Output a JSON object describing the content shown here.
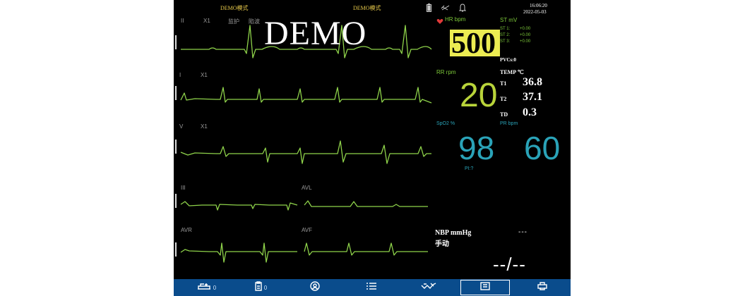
{
  "top_bar": {
    "mode_left": "DEMO模式",
    "mode_center": "DEMO模式",
    "time": "16:06:20",
    "date": "2022-05-03"
  },
  "watermark": "DEMO",
  "waves": [
    {
      "lead": "II",
      "gain": "X1",
      "mode": "监护",
      "filter": "陷波"
    },
    {
      "lead": "I",
      "gain": "X1"
    },
    {
      "lead": "V",
      "gain": "X1"
    },
    {
      "lead": "III",
      "lead2": "AVL"
    },
    {
      "lead": "AVR",
      "lead2": "AVF"
    }
  ],
  "hr": {
    "label": "HR bpm",
    "value": "500"
  },
  "st": {
    "label": "ST mV",
    "items": [
      {
        "label": "ST 1:",
        "value": "+0.00"
      },
      {
        "label": "ST 2:",
        "value": "+0.00"
      },
      {
        "label": "ST 3:",
        "value": "+0.00"
      }
    ]
  },
  "pvcs": "PVCs:0",
  "rr": {
    "label": "RR  rpm",
    "value": "20"
  },
  "temp": {
    "label": "TEMP ℃",
    "rows": [
      {
        "label": "T1",
        "value": "36.8"
      },
      {
        "label": "T2",
        "value": "37.1"
      },
      {
        "label": "TD",
        "value": "0.3"
      }
    ]
  },
  "spo2": {
    "label": "SpO2 %",
    "value": "98",
    "pi": "PI:?"
  },
  "pr": {
    "label": "PR  bpm",
    "value": "60"
  },
  "nbp": {
    "label": "NBP   mmHg",
    "mode": "手动",
    "mean": "---",
    "value": "--/--"
  },
  "toolbar": {
    "patient_count": "0",
    "report_count": "0"
  },
  "colors": {
    "wave": "#8ed24a",
    "hr_bg": "#ecec52",
    "teal": "#2aa3b8",
    "green": "#7dc93a",
    "toolbar": "#0a4c8c"
  }
}
